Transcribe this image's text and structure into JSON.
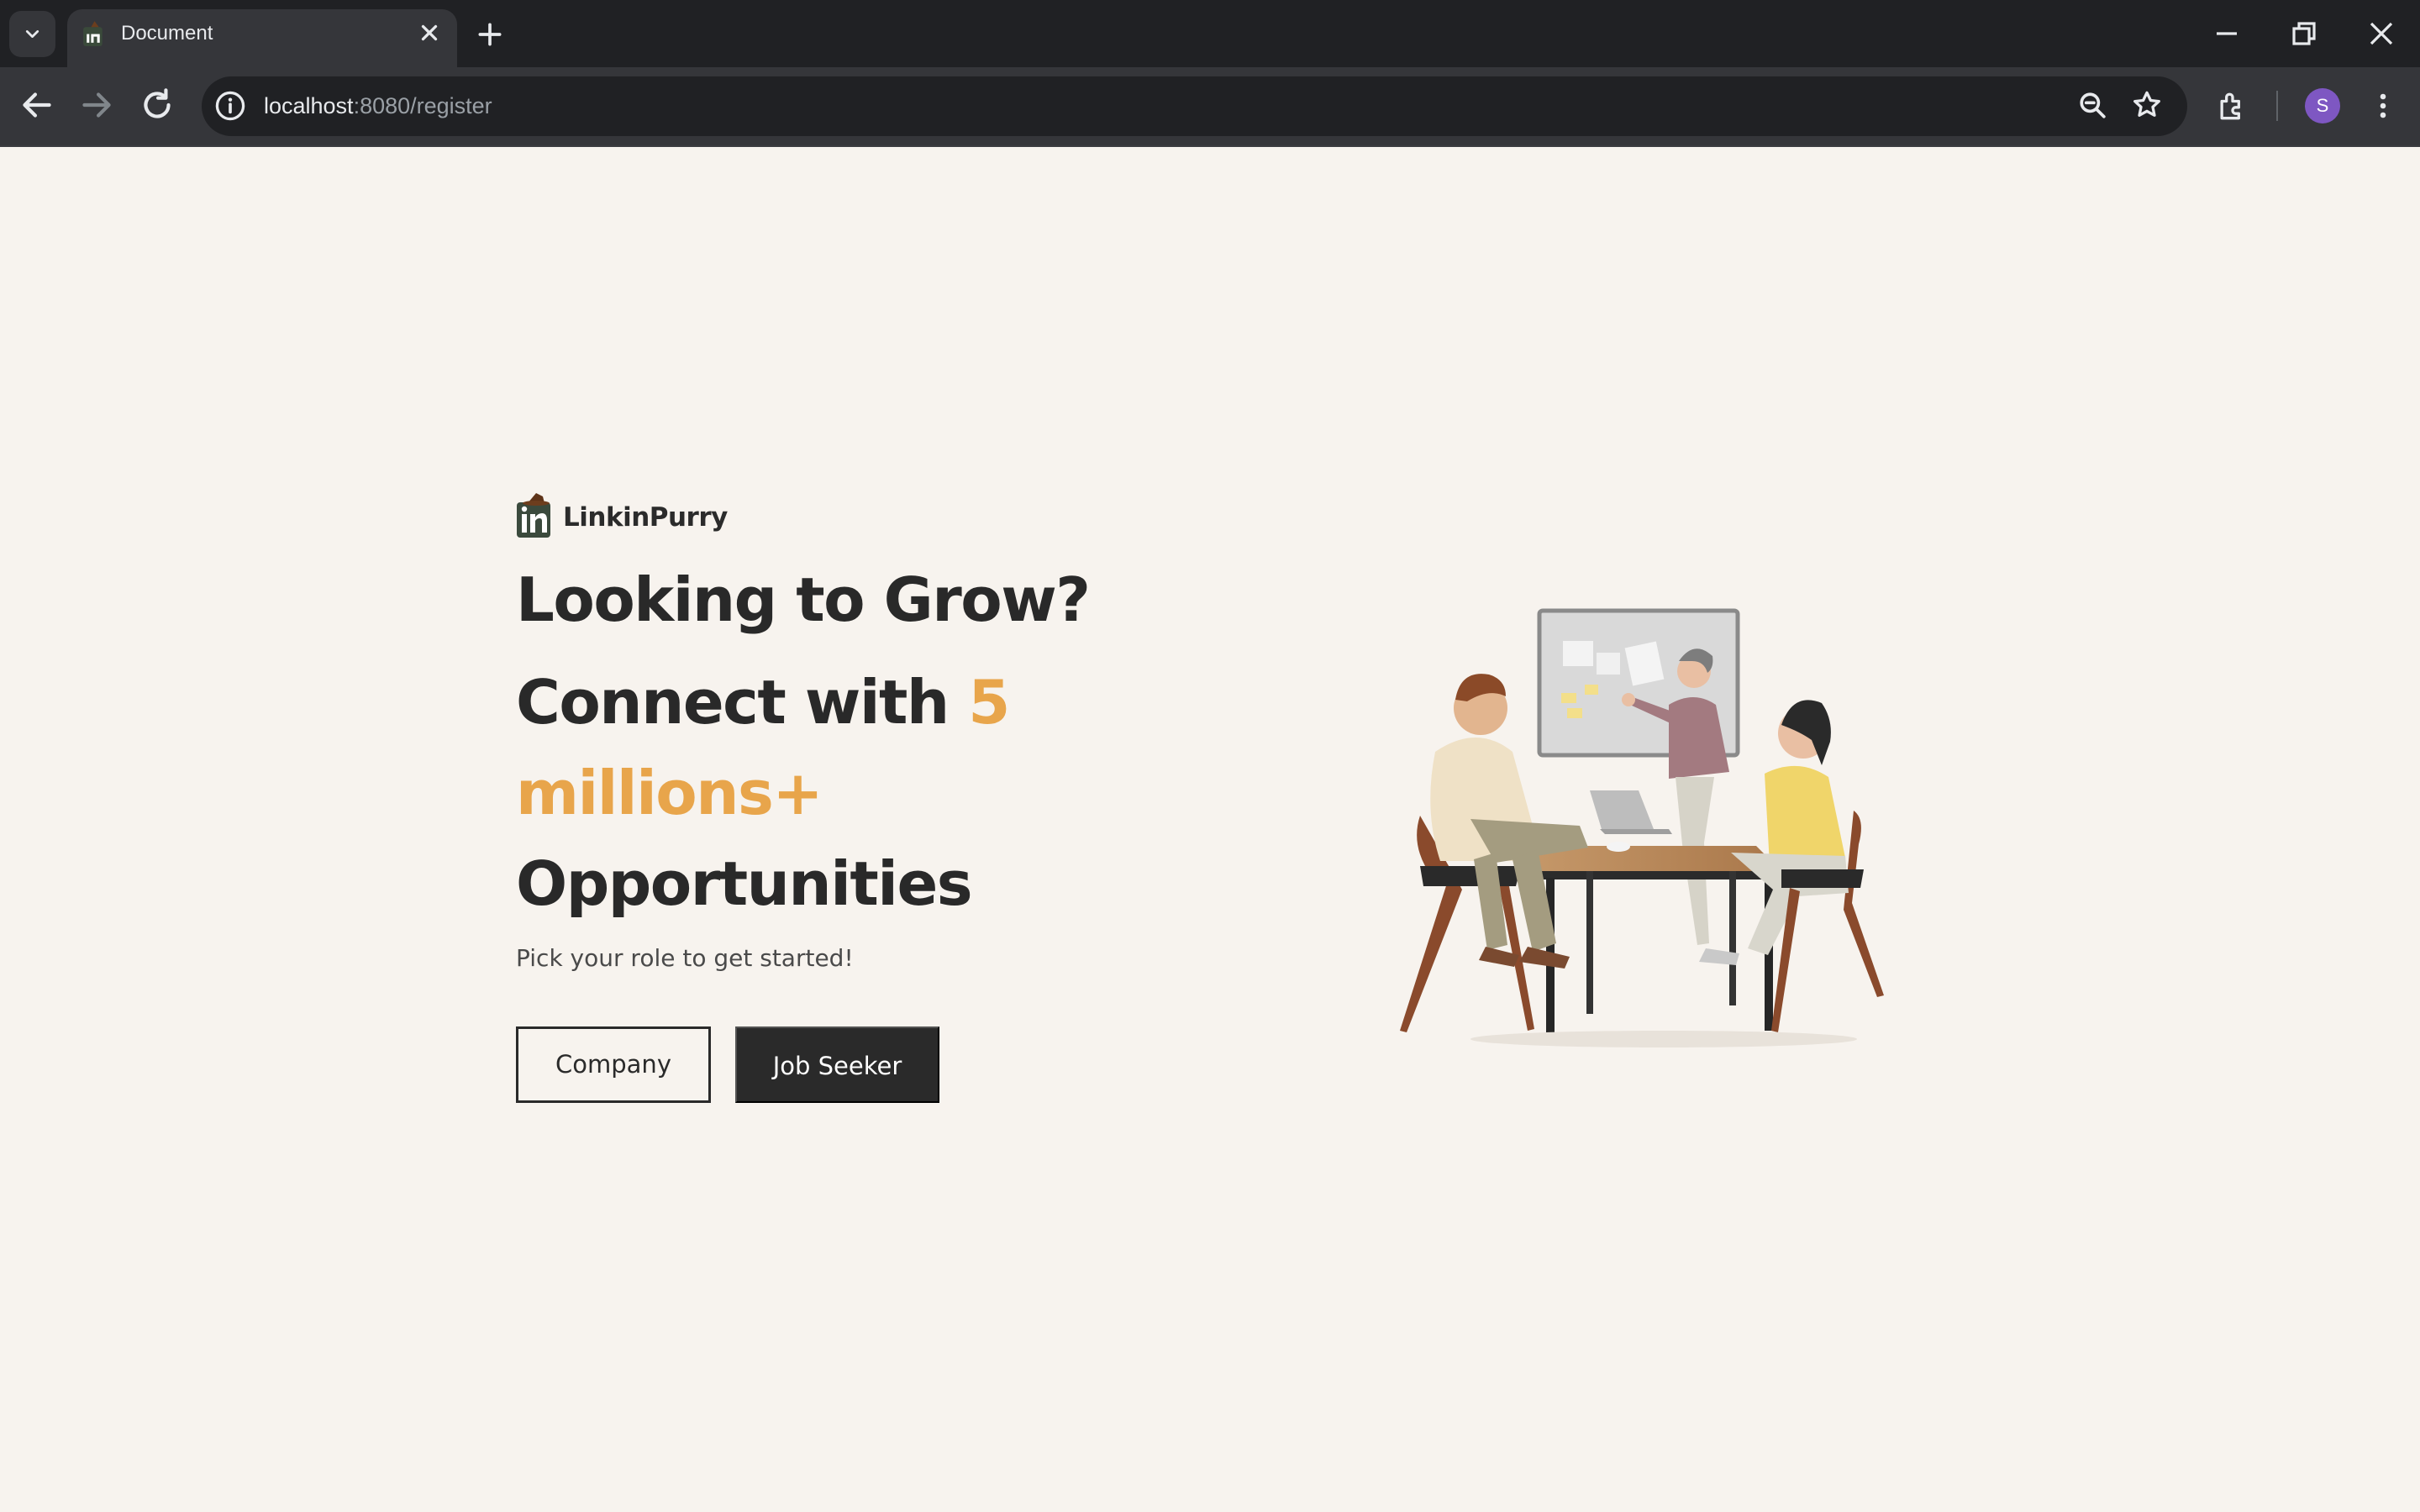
{
  "browser": {
    "tab": {
      "title": "Document",
      "favicon": "linkinpurry-favicon"
    },
    "url": {
      "host": "localhost",
      "rest": ":8080/register"
    },
    "profile_initial": "S",
    "icons": [
      "tab-search-icon",
      "close-icon",
      "plus-icon",
      "minimize-icon",
      "restore-icon",
      "window-close-icon",
      "back-arrow-icon",
      "forward-arrow-icon",
      "reload-icon",
      "site-info-icon",
      "zoom-icon",
      "star-icon",
      "extensions-icon",
      "more-vert-icon"
    ]
  },
  "page": {
    "logo_text": "LinkinPurry",
    "headline": {
      "line1": "Looking to Grow?",
      "line2_prefix": "Connect with ",
      "line2_accent": "5",
      "line3_accent": "millions+",
      "line4": "Opportunities"
    },
    "subtitle": "Pick your role to get started!",
    "buttons": {
      "company": "Company",
      "job_seeker": "Job Seeker"
    },
    "colors": {
      "background": "#f7f3ee",
      "accent": "#e8a54b",
      "dark": "#2a2a2a"
    }
  }
}
